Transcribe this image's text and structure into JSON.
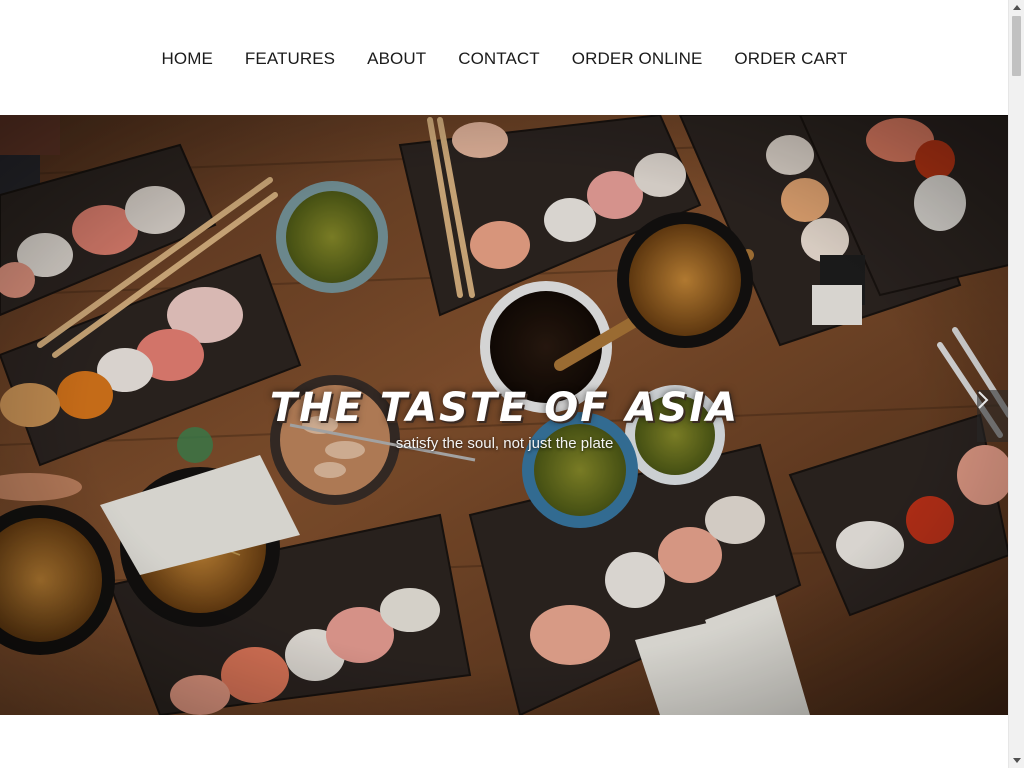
{
  "nav": {
    "items": [
      {
        "label": "HOME"
      },
      {
        "label": "FEATURES"
      },
      {
        "label": "ABOUT"
      },
      {
        "label": "CONTACT"
      },
      {
        "label": "ORDER ONLINE"
      },
      {
        "label": "ORDER CART"
      }
    ]
  },
  "hero": {
    "title": "THE TASTE OF ASIA",
    "subtitle": "satisfy the soul, not just the plate"
  },
  "icons": {
    "next": "chevron-right-icon",
    "scroll_up": "scroll-up-arrow-icon",
    "scroll_down": "scroll-down-arrow-icon"
  },
  "colors": {
    "nav_text": "#1b1b1b",
    "hero_text": "#ffffff",
    "table_wood": "#7a4a2a"
  }
}
